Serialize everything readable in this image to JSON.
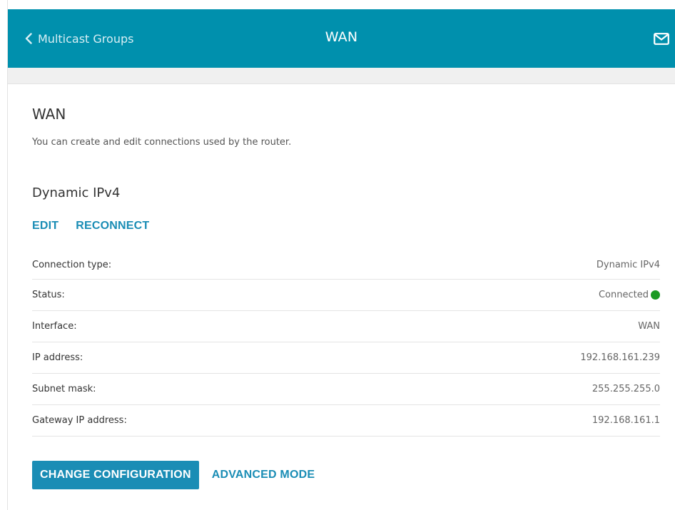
{
  "header": {
    "back_label": "Multicast Groups",
    "title": "WAN",
    "mail_icon": "mail-icon",
    "color": "#0090ad"
  },
  "page": {
    "title": "WAN",
    "description": "You can create and edit connections used by the router."
  },
  "connection": {
    "title": "Dynamic IPv4",
    "actions": {
      "edit": "EDIT",
      "reconnect": "RECONNECT"
    },
    "rows": [
      {
        "label": "Connection type:",
        "value": "Dynamic IPv4"
      },
      {
        "label": "Status:",
        "value": "Connected",
        "status_color": "#1a9a22"
      },
      {
        "label": "Interface:",
        "value": "WAN"
      },
      {
        "label": "IP address:",
        "value": "192.168.161.239"
      },
      {
        "label": "Subnet mask:",
        "value": "255.255.255.0"
      },
      {
        "label": "Gateway IP address:",
        "value": "192.168.161.1"
      }
    ]
  },
  "footer": {
    "change_configuration": "CHANGE CONFIGURATION",
    "advanced_mode": "ADVANCED MODE"
  },
  "colors": {
    "accent": "#1a8db5"
  }
}
